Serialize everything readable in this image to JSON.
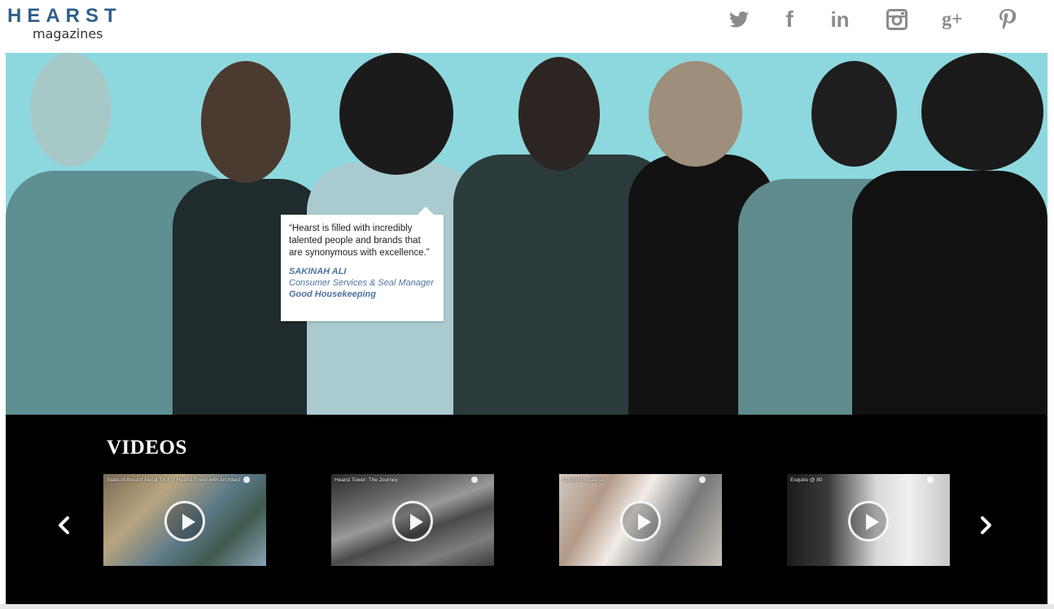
{
  "logo": {
    "main": "HEARST",
    "sub": "magazines"
  },
  "social": {
    "twitter": "twitter-icon",
    "facebook": "f",
    "linkedin": "in",
    "instagram": "instagram-icon",
    "gplus": "g+",
    "pinterest": "pinterest-icon"
  },
  "quote": {
    "text": "“Hearst is filled with incredibly talented people and brands that are synonymous with excellence.”",
    "name": "SAKINAH ALI",
    "role": "Consumer Services & Seal Manager",
    "brand": "Good Housekeeping"
  },
  "videos": {
    "title": "VIDEOS",
    "items": [
      {
        "title": "State-of-the-Art Aerial Tour of Hearst Tower with Architect"
      },
      {
        "title": "Hearst Tower: The Journey"
      },
      {
        "title": "Cosmo for Latinas"
      },
      {
        "title": "Esquire @ 80"
      }
    ]
  },
  "colors": {
    "brand": "#2f5f8a",
    "hero_bg": "#8dd8de",
    "quote_accent": "#4f74a0"
  }
}
